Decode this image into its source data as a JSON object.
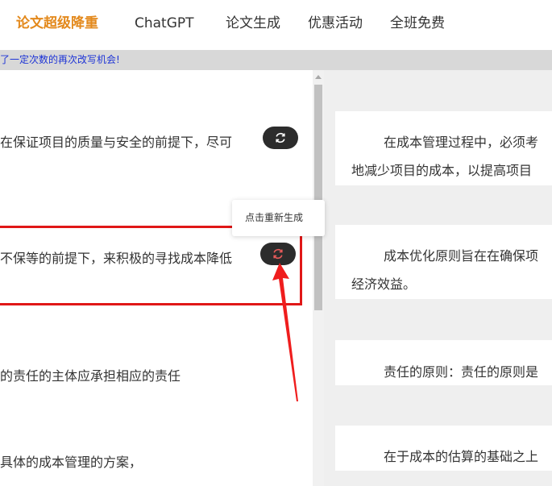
{
  "nav": {
    "items": [
      {
        "label": "论文超级降重",
        "active": true
      },
      {
        "label": "ChatGPT",
        "active": false
      },
      {
        "label": "论文生成",
        "active": false
      },
      {
        "label": "优惠活动",
        "active": false
      },
      {
        "label": "全班免费",
        "active": false
      }
    ]
  },
  "notice": {
    "text": "了一定次数的再次改写机会!"
  },
  "left": {
    "lines": [
      "在保证项目的质量与安全的前提下，尽可",
      "不保等的前提下，来积极的寻找成本降低",
      "的责任的主体应承担相应的责任",
      "具体的成本管理的方案，"
    ]
  },
  "tooltip": {
    "text": "点击重新生成"
  },
  "right": {
    "cards": [
      {
        "lines": [
          "在成本管理过程中，必须考",
          "地减少项目的成本，以提高项目"
        ]
      },
      {
        "lines": [
          "成本优化原则旨在在确保项",
          "经济效益。"
        ]
      },
      {
        "lines": [
          "责任的原则：责任的原则是"
        ]
      },
      {
        "lines": [
          "在于成本的估算的基础之上"
        ]
      }
    ]
  },
  "colors": {
    "accent": "#e3891c",
    "notice_bg": "#d8d8d8",
    "notice_text": "#1d33d6",
    "highlight": "#e01717",
    "regen_active_icon": "#e85a5a",
    "regen_icon": "#ffffff",
    "pane_bg": "#efefef"
  },
  "icons": {
    "regenerate": "refresh-icon",
    "annotation": "red-arrow"
  }
}
